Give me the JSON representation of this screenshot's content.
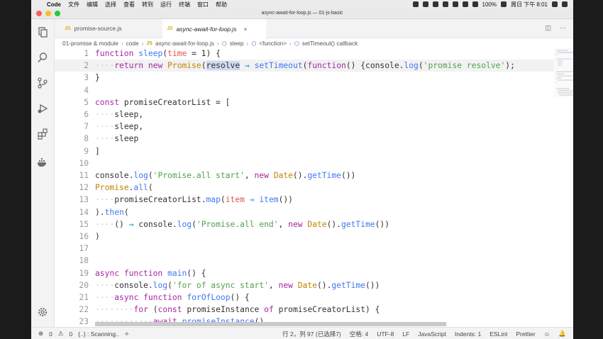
{
  "menubar": {
    "app": "Code",
    "items": [
      "文件",
      "编辑",
      "选择",
      "查看",
      "转到",
      "运行",
      "终端",
      "窗口",
      "帮助"
    ],
    "battery": "100%",
    "clock": "周日 下午 8:01"
  },
  "window": {
    "title": "async-await-for-loop.js — 01-js-basic"
  },
  "tabs": [
    {
      "label": "promise-source.js",
      "icon": "JS"
    },
    {
      "label": "async-await-for-loop.js",
      "icon": "JS"
    }
  ],
  "breadcrumb": [
    "01-promise & module",
    "code",
    "async-await-for-loop.js",
    "sleep",
    "<function>",
    "setTimeout() callback"
  ],
  "code_lines": [
    {
      "n": "1",
      "t": "function sleep(time = 1) {"
    },
    {
      "n": "2",
      "t": "    return new Promise(resolve ⇒ setTimeout(function() {console.log('promise resolve');"
    },
    {
      "n": "3",
      "t": "}"
    },
    {
      "n": "4",
      "t": ""
    },
    {
      "n": "5",
      "t": "const promiseCreatorList = ["
    },
    {
      "n": "6",
      "t": "    sleep,"
    },
    {
      "n": "7",
      "t": "    sleep,"
    },
    {
      "n": "8",
      "t": "    sleep"
    },
    {
      "n": "9",
      "t": "]"
    },
    {
      "n": "10",
      "t": ""
    },
    {
      "n": "11",
      "t": "console.log('Promise.all start', new Date().getTime())"
    },
    {
      "n": "12",
      "t": "Promise.all("
    },
    {
      "n": "13",
      "t": "    promiseCreatorList.map(item ⇒ item())"
    },
    {
      "n": "14",
      "t": ").then("
    },
    {
      "n": "15",
      "t": "    () ⇒ console.log('Promise.all end', new Date().getTime())"
    },
    {
      "n": "16",
      "t": ")"
    },
    {
      "n": "17",
      "t": ""
    },
    {
      "n": "18",
      "t": ""
    },
    {
      "n": "19",
      "t": "async function main() {"
    },
    {
      "n": "20",
      "t": "    console.log('for of async start', new Date().getTime())"
    },
    {
      "n": "21",
      "t": "    async function forOfLoop() {"
    },
    {
      "n": "22",
      "t": "        for (const promiseInstance of promiseCreatorList) {"
    },
    {
      "n": "23",
      "t": "            await promiseInstance()"
    }
  ],
  "status": {
    "errors": "0",
    "warnings": "0",
    "scanning": "{..} : Scanning..",
    "position": "行 2，列 97 (已选择7)",
    "spaces": "空格: 4",
    "encoding": "UTF-8",
    "eol": "LF",
    "language": "JavaScript",
    "indents": "Indents: 1",
    "eslint": "ESLint",
    "prettier": "Prettier"
  }
}
